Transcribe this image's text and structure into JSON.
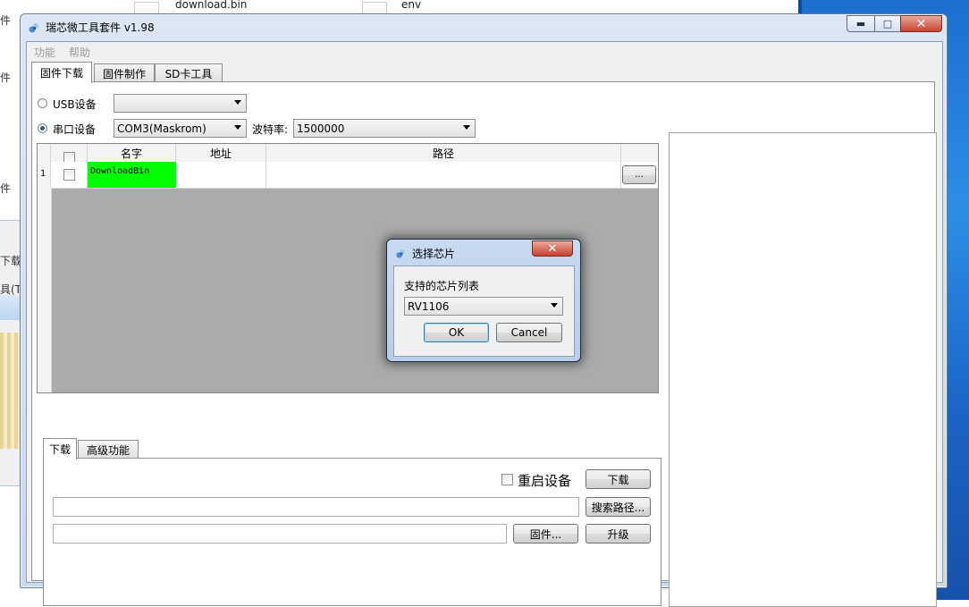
{
  "background": {
    "files": [
      {
        "name": "download.bin"
      },
      {
        "name": "env"
      }
    ],
    "left_labels": [
      "件",
      "件",
      "件",
      "下载",
      "具(T"
    ]
  },
  "window": {
    "title": "瑞芯微工具套件 v1.98",
    "caption": {
      "minimize": "▬",
      "maximize": "□",
      "close": "✕"
    }
  },
  "menu": {
    "items": [
      "功能",
      "帮助"
    ]
  },
  "tabs": {
    "items": [
      "固件下载",
      "固件制作",
      "SD卡工具"
    ],
    "active": 0
  },
  "connection": {
    "usb_label": "USB设备",
    "usb_value": "",
    "serial_label": "串口设备",
    "serial_selected": true,
    "serial_value": "COM3(Maskrom)",
    "baud_label": "波特率:",
    "baud_value": "1500000"
  },
  "grid": {
    "headers": [
      "",
      "名字",
      "地址",
      "路径",
      ""
    ],
    "rows": [
      {
        "index": "1",
        "checked": false,
        "name": "DownloadBin",
        "address": "",
        "path": "",
        "browse": "..."
      }
    ]
  },
  "bottom_tabs": {
    "items": [
      "下载",
      "高级功能"
    ],
    "active": 0
  },
  "download_panel": {
    "restart_label": "重启设备",
    "restart_checked": false,
    "download_button": "下载",
    "search_path_button": "搜索路径...",
    "firmware_button": "固件...",
    "upgrade_button": "升级",
    "search_path_value": "",
    "firmware_value": ""
  },
  "dialog": {
    "title": "选择芯片",
    "close": "✕",
    "list_label": "支持的芯片列表",
    "chip_value": "RV1106",
    "ok": "OK",
    "cancel": "Cancel"
  },
  "colors": {
    "name_cell_bg": "#00ff00",
    "aero_blue": "#2c8fe6",
    "close_red": "#c8412e"
  }
}
